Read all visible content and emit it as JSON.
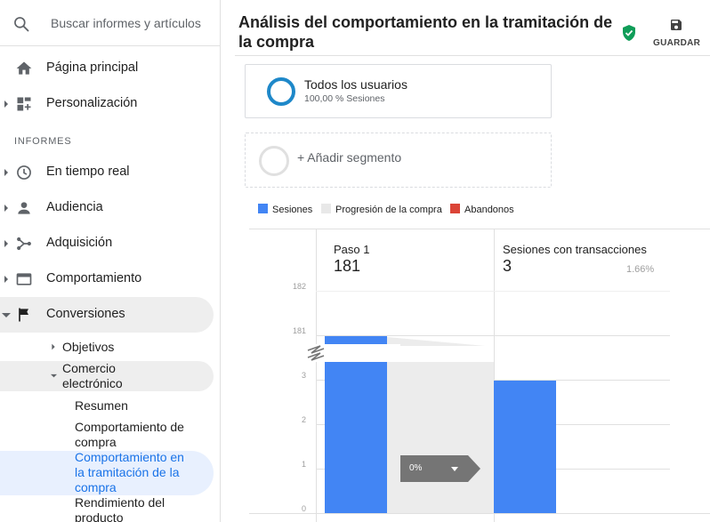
{
  "sidebar": {
    "search_placeholder": "Buscar informes y artículos",
    "top_items": [
      {
        "label": "Página principal"
      },
      {
        "label": "Personalización"
      }
    ],
    "section_title": "INFORMES",
    "report_items": [
      {
        "label": "En tiempo real"
      },
      {
        "label": "Audiencia"
      },
      {
        "label": "Adquisición"
      },
      {
        "label": "Comportamiento"
      },
      {
        "label": "Conversiones"
      }
    ],
    "sub_items": [
      {
        "label": "Objetivos"
      },
      {
        "label": "Comercio electrónico"
      }
    ],
    "leaf_items": [
      {
        "label": "Resumen"
      },
      {
        "label": "Comportamiento de compra"
      },
      {
        "label": "Comportamiento en la tramitación de la compra"
      },
      {
        "label": "Rendimiento del producto"
      }
    ]
  },
  "header": {
    "title": "Análisis del comportamiento en la tramitación de la compra",
    "save_label": "GUARDAR"
  },
  "segments": {
    "active_name": "Todos los usuarios",
    "active_pct": "100,00 % Sesiones",
    "add_label": "+ Añadir segmento"
  },
  "legend": [
    {
      "label": "Sesiones",
      "color": "#4285f4"
    },
    {
      "label": "Progresión de la compra",
      "color": "#e8e8e8"
    },
    {
      "label": "Abandonos",
      "color": "#db4437"
    }
  ],
  "chart_data": {
    "type": "bar",
    "steps": [
      {
        "name": "Paso 1",
        "value": "181",
        "pct": ""
      },
      {
        "name": "Sesiones con transacciones",
        "value": "3",
        "pct": "1.66%"
      }
    ],
    "y_ticks": [
      "182",
      "181",
      "3",
      "2",
      "1",
      "0"
    ],
    "values": [
      181,
      3
    ],
    "progression_label": "0%"
  }
}
